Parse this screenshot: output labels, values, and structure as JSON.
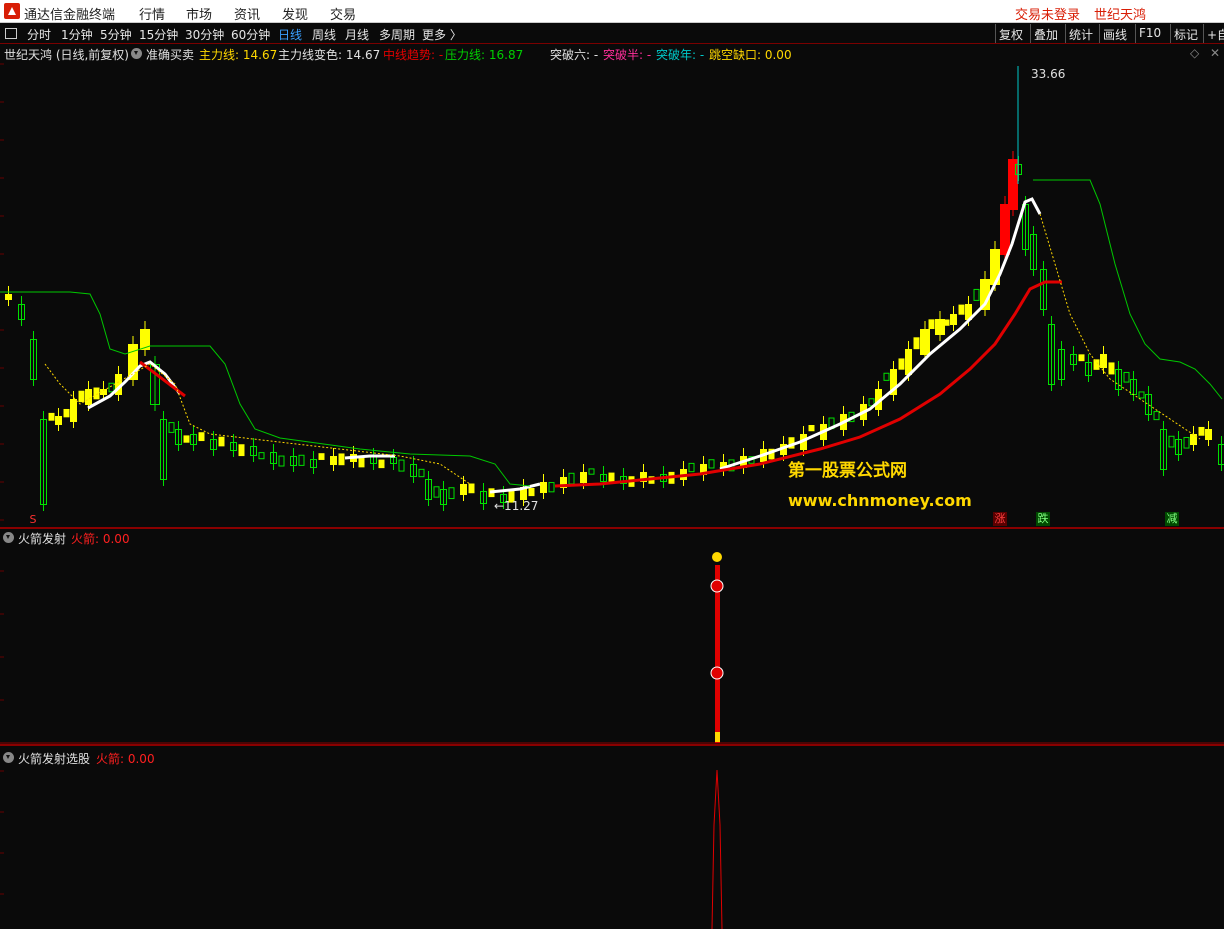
{
  "app": {
    "title": "通达信金融终端",
    "login": "交易未登录",
    "stock_name": "世纪天鸿"
  },
  "menu": [
    "行情",
    "市场",
    "资讯",
    "发现",
    "交易"
  ],
  "periods": [
    "分时",
    "1分钟",
    "5分钟",
    "15分钟",
    "30分钟",
    "60分钟",
    "日线",
    "周线",
    "月线",
    "多周期",
    "更多 〉"
  ],
  "active_period": "日线",
  "right_buttons": [
    "复权",
    "叠加",
    "统计",
    "画线",
    "F10",
    "标记",
    "+自"
  ],
  "info": {
    "stock": "世纪天鸿 (日线,前复权)",
    "indicator": "准确买卖",
    "main_line": "主力线: 14.67",
    "main_color": "主力线变色: 14.67",
    "mid_trend": "中线趋势: -",
    "pressure": "压力线: 16.87",
    "break6": "突破六: -",
    "break_half": "突破半: -",
    "break_year": "突破年: -",
    "gap": "跳空缺口: 0.00"
  },
  "annotations": {
    "high": "33.66",
    "low": "←11.27",
    "signal_s": "S",
    "zhang": "涨",
    "die": "跌",
    "jian": "减"
  },
  "watermark": {
    "line1": "第一股票公式网",
    "line2": "www.chnmoney.com"
  },
  "panel2": {
    "name": "火箭发射",
    "label": "火箭: 0.00"
  },
  "panel3": {
    "name": "火箭发射选股",
    "label": "火箭: 0.00"
  },
  "colors": {
    "up": "#ffff00",
    "up_alt": "#ff0000",
    "down": "#00e000",
    "main_line": "#ffffff",
    "trend_line": "#e00000",
    "pressure_line": "#00c800"
  }
}
